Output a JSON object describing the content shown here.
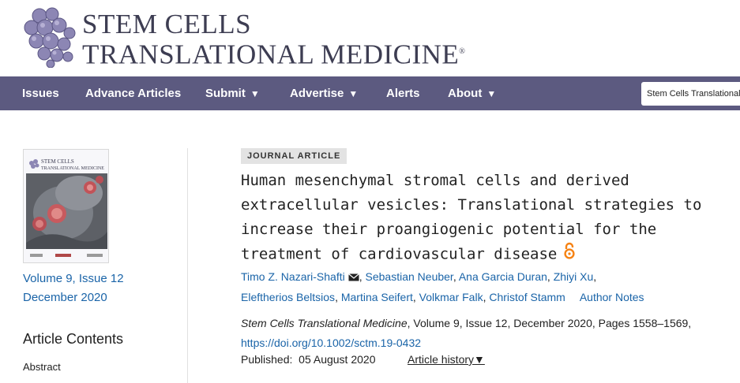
{
  "header": {
    "logo_line1": "STEM CELLS",
    "logo_line2": "TRANSLATIONAL MEDICINE",
    "logo_tm": "®"
  },
  "nav": {
    "items": [
      {
        "label": "Issues",
        "has_caret": false
      },
      {
        "label": "Advance Articles",
        "has_caret": false
      },
      {
        "label": "Submit",
        "has_caret": true
      },
      {
        "label": "Advertise",
        "has_caret": true
      },
      {
        "label": "Alerts",
        "has_caret": false
      },
      {
        "label": "About",
        "has_caret": true
      }
    ],
    "caret": "▼",
    "search_scope": "Stem Cells Translational"
  },
  "sidebar": {
    "cover_title_line1": "STEM CELLS",
    "cover_title_line2": "TRANSLATIONAL MEDICINE",
    "issue": "Volume 9, Issue 12",
    "issue_date": "December 2020",
    "contents_heading": "Article Contents",
    "contents_items": [
      "Abstract"
    ]
  },
  "article": {
    "type_badge": "JOURNAL ARTICLE",
    "title": "Human mesenchymal stromal cells and derived extracellular vesicles: Translational strategies to increase their proangiogenic potential for the treatment of cardiovascular disease",
    "authors": [
      "Timo Z. Nazari-Shafti",
      "Sebastian Neuber",
      "Ana Garcia Duran",
      "Zhiyi Xu",
      "Eleftherios Beltsios",
      "Martina Seifert",
      "Volkmar Falk",
      "Christof Stamm"
    ],
    "author_notes": "Author Notes",
    "citation_journal": "Stem Cells Translational Medicine",
    "citation_details": ", Volume 9, Issue 12, December 2020, Pages 1558–1569, ",
    "doi": "https://doi.org/10.1002/sctm.19-0432",
    "published_label": "Published:",
    "published_date": "05 August 2020",
    "history_label": "Article history",
    "history_caret": "▼"
  },
  "colors": {
    "nav_bg": "#5c5a80",
    "link": "#1a64a8",
    "open_access": "#f68212"
  }
}
